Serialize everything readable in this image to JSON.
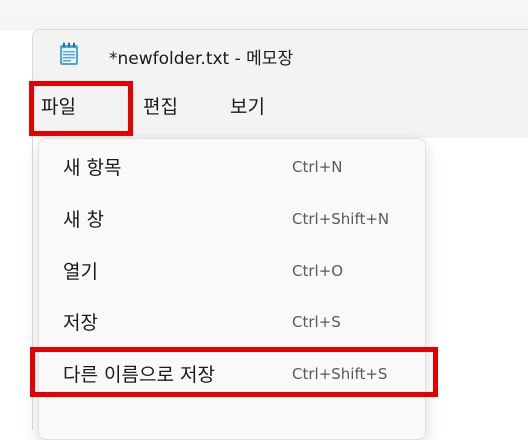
{
  "window": {
    "title": "*newfolder.txt - 메모장",
    "app_icon": "notepad-icon"
  },
  "menubar": {
    "items": [
      {
        "label": "파일"
      },
      {
        "label": "편집"
      },
      {
        "label": "보기"
      }
    ]
  },
  "file_menu": {
    "items": [
      {
        "label": "새 항목",
        "shortcut": "Ctrl+N"
      },
      {
        "label": "새 창",
        "shortcut": "Ctrl+Shift+N"
      },
      {
        "label": "열기",
        "shortcut": "Ctrl+O"
      },
      {
        "label": "저장",
        "shortcut": "Ctrl+S"
      },
      {
        "label": "다른 이름으로 저장",
        "shortcut": "Ctrl+Shift+S"
      }
    ]
  },
  "colors": {
    "highlight": "#e60000",
    "menu_background": "#f9f9f9",
    "titlebar_background": "#f3f3f3"
  }
}
